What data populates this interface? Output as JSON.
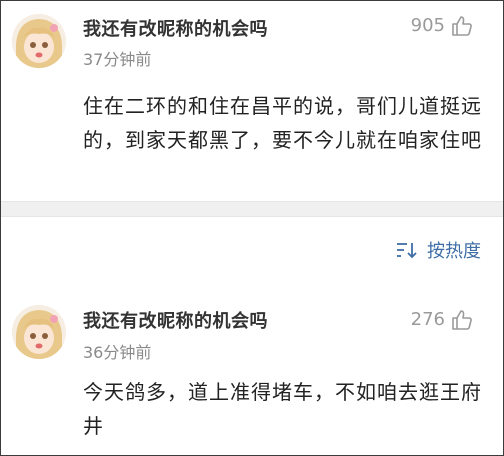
{
  "comments": [
    {
      "user_name": "我还有改昵称的机会吗",
      "time": "37分钟前",
      "like_count": "905",
      "text": "住在二环的和住在昌平的说，哥们儿道挺远的，到家天都黑了，要不今儿就在咱家住吧"
    },
    {
      "user_name": "我还有改昵称的机会吗",
      "time": "36分钟前",
      "like_count": "276",
      "text": "今天鸽多，道上准得堵车，不如咱去逛王府井"
    }
  ],
  "sort": {
    "label": "按热度"
  },
  "colors": {
    "accent": "#3f6ea6",
    "muted": "#8a8a8a",
    "band": "#f0f0f0"
  }
}
